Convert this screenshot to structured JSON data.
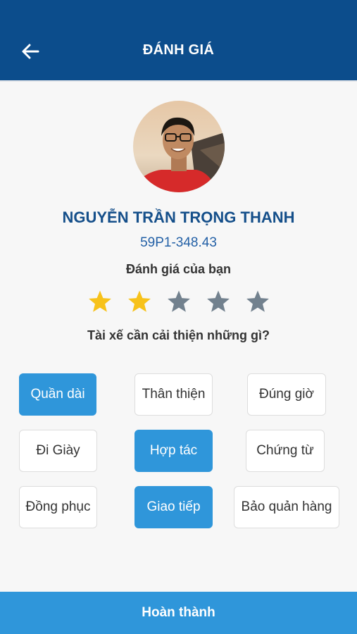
{
  "header": {
    "title": "ĐÁNH GIÁ",
    "back_icon": "arrow-left-icon"
  },
  "colors": {
    "header_bg": "#0c4d8c",
    "accent": "#2f96da",
    "star_active": "#f7c21a",
    "star_inactive": "#72818e",
    "name_color": "#154f8a"
  },
  "driver": {
    "name": "NGUYỄN TRẦN TRỌNG THANH",
    "plate": "59P1-348.43"
  },
  "rating": {
    "label": "Đánh giá của bạn",
    "value": 2,
    "max": 5
  },
  "improve": {
    "question": "Tài xế cần cải thiện những gì?",
    "tags": [
      {
        "label": "Quần dài",
        "selected": true
      },
      {
        "label": "Thân thiện",
        "selected": false
      },
      {
        "label": "Đúng giờ",
        "selected": false
      },
      {
        "label": "Đi Giày",
        "selected": false
      },
      {
        "label": "Hợp tác",
        "selected": true
      },
      {
        "label": "Chứng từ",
        "selected": false
      },
      {
        "label": "Đồng phục",
        "selected": false
      },
      {
        "label": "Giao tiếp",
        "selected": true
      },
      {
        "label": "Bảo quản hàng",
        "selected": false
      }
    ]
  },
  "footer": {
    "submit_label": "Hoàn thành"
  }
}
